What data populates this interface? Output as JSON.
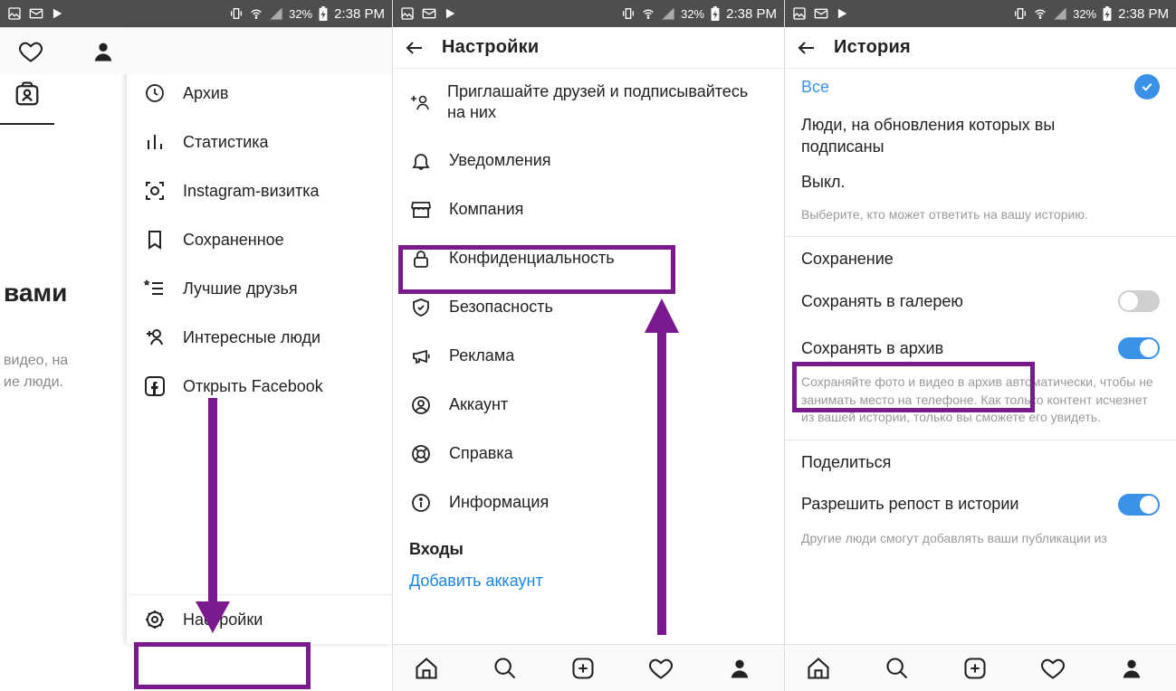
{
  "status": {
    "battery": "32%",
    "time": "2:38 PM"
  },
  "screen1": {
    "left_tab": "вами",
    "left_text1": "видео, на",
    "left_text2": "ие люди.",
    "items": {
      "archive": "Архив",
      "stats": "Статистика",
      "nametag": "Instagram-визитка",
      "saved": "Сохраненное",
      "close_friends": "Лучшие друзья",
      "discover": "Интересные люди",
      "facebook": "Открыть Facebook",
      "settings": "Настройки"
    }
  },
  "screen2": {
    "title": "Настройки",
    "items": {
      "invite": "Приглашайте друзей и подписывайтесь на них",
      "notifications": "Уведомления",
      "business": "Компания",
      "privacy": "Конфиденциальность",
      "security": "Безопасность",
      "ads": "Реклама",
      "account": "Аккаунт",
      "help": "Справка",
      "about": "Информация"
    },
    "logins": "Входы",
    "add_account": "Добавить аккаунт"
  },
  "screen3": {
    "title": "История",
    "replies_all": "Все",
    "replies_follow": "Люди, на обновления которых вы подписаны",
    "replies_off": "Выкл.",
    "replies_hint": "Выберите, кто может ответить на вашу историю.",
    "saving_header": "Сохранение",
    "save_gallery": "Сохранять в галерею",
    "save_archive": "Сохранять в архив",
    "archive_hint": "Сохраняйте фото и видео в архив автоматически, чтобы не занимать место на телефоне. Как только контент исчезнет из вашей истории, только вы сможете его увидеть.",
    "share_header": "Поделиться",
    "allow_reshare": "Разрешить репост в истории",
    "reshare_hint": "Другие люди смогут добавлять ваши публикации из"
  }
}
